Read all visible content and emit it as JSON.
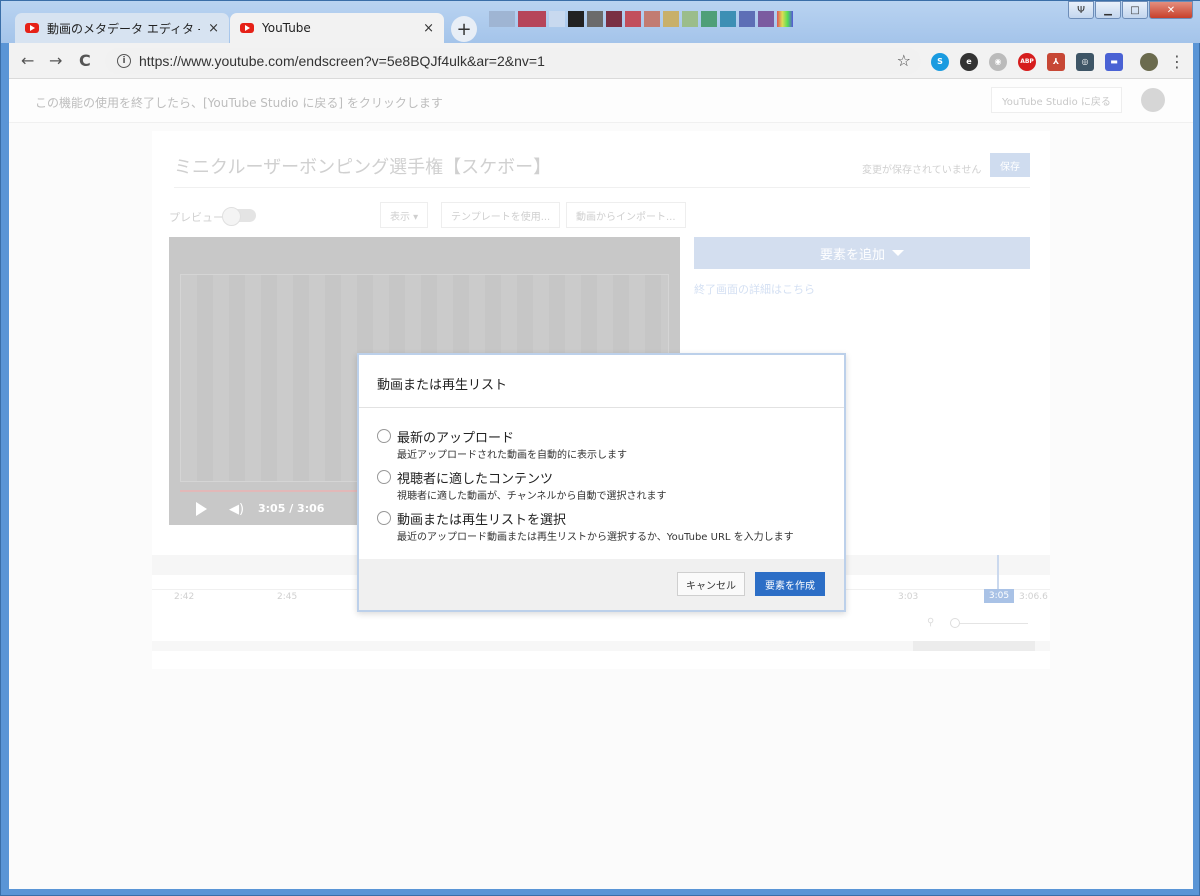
{
  "browser": {
    "tabs": [
      {
        "label": "動画のメタデータ エディタ - Yo",
        "close": "×"
      },
      {
        "label": "YouTube",
        "close": "×"
      }
    ],
    "new_tab": "+",
    "url": "https://www.youtube.com/endscreen?v=5e8BQJf4ulk&ar=2&nv=1",
    "nav": {
      "back": "←",
      "forward": "→",
      "reload": "C"
    },
    "star": "☆",
    "extensions": [
      "skype-icon",
      "e-icon",
      "ghost-icon",
      "abp-icon",
      "pdf-icon",
      "eye-icon",
      "chat-icon",
      "profile-icon"
    ],
    "extension_labels": {
      "skype": "S",
      "e": "e",
      "ghost": "◉",
      "abp": "ABP",
      "pdf": "⅄",
      "eye": "◎",
      "chat": "▬"
    },
    "menu": "⋮",
    "window_buttons": {
      "minimize": "▁",
      "maximize": "□",
      "close": "✕",
      "user": "Ψ"
    }
  },
  "page": {
    "topbar_message": "この機能の使用を終了したら、[YouTube Studio に戻る] をクリックします",
    "back_to_studio": "YouTube Studio に戻る",
    "video_title": "ミニクルーザーボンピング選手権【スケボー】",
    "unsaved": "変更が保存されていません",
    "save": "保存",
    "preview": "プレビュー",
    "show": "表示 ▾",
    "use_template": "テンプレートを使用...",
    "import_from_video": "動画からインポート...",
    "player_time": "3:05 / 3:06",
    "add_element": "要素を追加",
    "endscreen_details": "終了画面の詳細はこちら",
    "timeline_ticks": [
      "2:42",
      "2:45",
      "3:03",
      "3:06.6"
    ],
    "current_time": "3:05"
  },
  "dialog": {
    "title": "動画または再生リスト",
    "options": [
      {
        "label": "最新のアップロード",
        "desc": "最近アップロードされた動画を自動的に表示します"
      },
      {
        "label": "視聴者に適したコンテンツ",
        "desc": "視聴者に適した動画が、チャンネルから自動で選択されます"
      },
      {
        "label": "動画または再生リストを選択",
        "desc": "最近のアップロード動画または再生リストから選択するか、YouTube URL を入力します"
      }
    ],
    "cancel": "キャンセル",
    "create": "要素を作成"
  },
  "colors": {
    "accent": "#2c6ec6",
    "youtube_red": "#e62117",
    "window_frame": "#5a95d6"
  }
}
